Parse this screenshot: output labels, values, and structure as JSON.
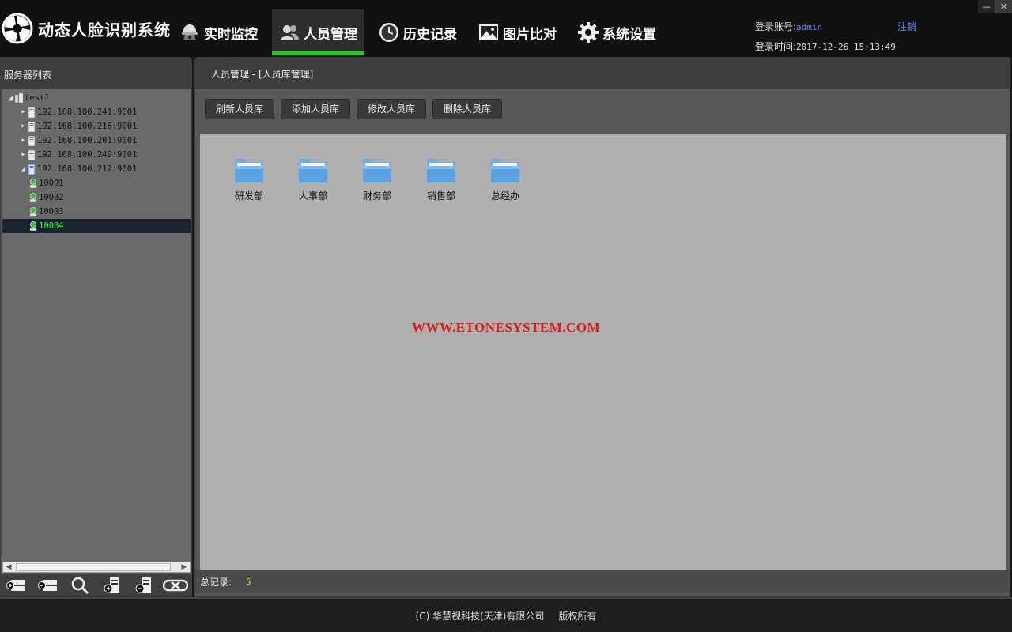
{
  "app": {
    "title": "动态人脸识别系统",
    "logo_icon": "aperture-logo-icon"
  },
  "nav": [
    {
      "label": "实时监控",
      "icon": "surveillance-camera-icon",
      "active": false
    },
    {
      "label": "人员管理",
      "icon": "users-icon",
      "active": true
    },
    {
      "label": "历史记录",
      "icon": "clock-icon",
      "active": false
    },
    {
      "label": "图片比对",
      "icon": "image-icon",
      "active": false
    },
    {
      "label": "系统设置",
      "icon": "gear-icon",
      "active": false
    }
  ],
  "login": {
    "account_label": "登录账号:",
    "account_value": "admin",
    "time_label": "登录时间:",
    "time_value": "2017-12-26 15:13:49",
    "logout_label": "注销"
  },
  "window_controls": {
    "minimize": "—",
    "close": "✕"
  },
  "sidebar": {
    "title": "服务器列表",
    "tree": [
      {
        "label": "test1",
        "type": "root",
        "arrow": "expanded"
      },
      {
        "label": "192.168.100.241:9001",
        "type": "server",
        "arrow": "collapsed"
      },
      {
        "label": "192.168.100.216:9001",
        "type": "server",
        "arrow": "collapsed"
      },
      {
        "label": "192.168.100.201:9001",
        "type": "server",
        "arrow": "collapsed"
      },
      {
        "label": "192.168.100.249:9001",
        "type": "server",
        "arrow": "collapsed"
      },
      {
        "label": "192.168.100.212:9001",
        "type": "server",
        "arrow": "expanded"
      },
      {
        "label": "10001",
        "type": "camera"
      },
      {
        "label": "10002",
        "type": "camera"
      },
      {
        "label": "10003",
        "type": "camera"
      },
      {
        "label": "10004",
        "type": "camera",
        "selected": true
      }
    ],
    "tools": [
      "add-server-icon",
      "remove-server-icon",
      "search-icon",
      "add-device-icon",
      "remove-device-icon",
      "disconnect-icon"
    ]
  },
  "main": {
    "breadcrumb": "人员管理 - [人员库管理]",
    "buttons": {
      "refresh": "刷新人员库",
      "add": "添加人员库",
      "edit": "修改人员库",
      "delete": "删除人员库"
    },
    "folders": [
      {
        "label": "研发部"
      },
      {
        "label": "人事部"
      },
      {
        "label": "财务部"
      },
      {
        "label": "销售部"
      },
      {
        "label": "总经办"
      }
    ],
    "watermark": "WWW.ETONESYSTEM.COM",
    "status": {
      "total_label": "总记录:",
      "total_value": "5"
    }
  },
  "footer": {
    "company": "(C) 华慧视科技(天津)有限公司",
    "rights": "版权所有"
  },
  "colors": {
    "accent_green": "#1dcf1d",
    "link_blue": "#5b86e8",
    "watermark_red": "#e01818",
    "selected_text": "#2dff2d",
    "count_yellow": "#c7e34a"
  }
}
